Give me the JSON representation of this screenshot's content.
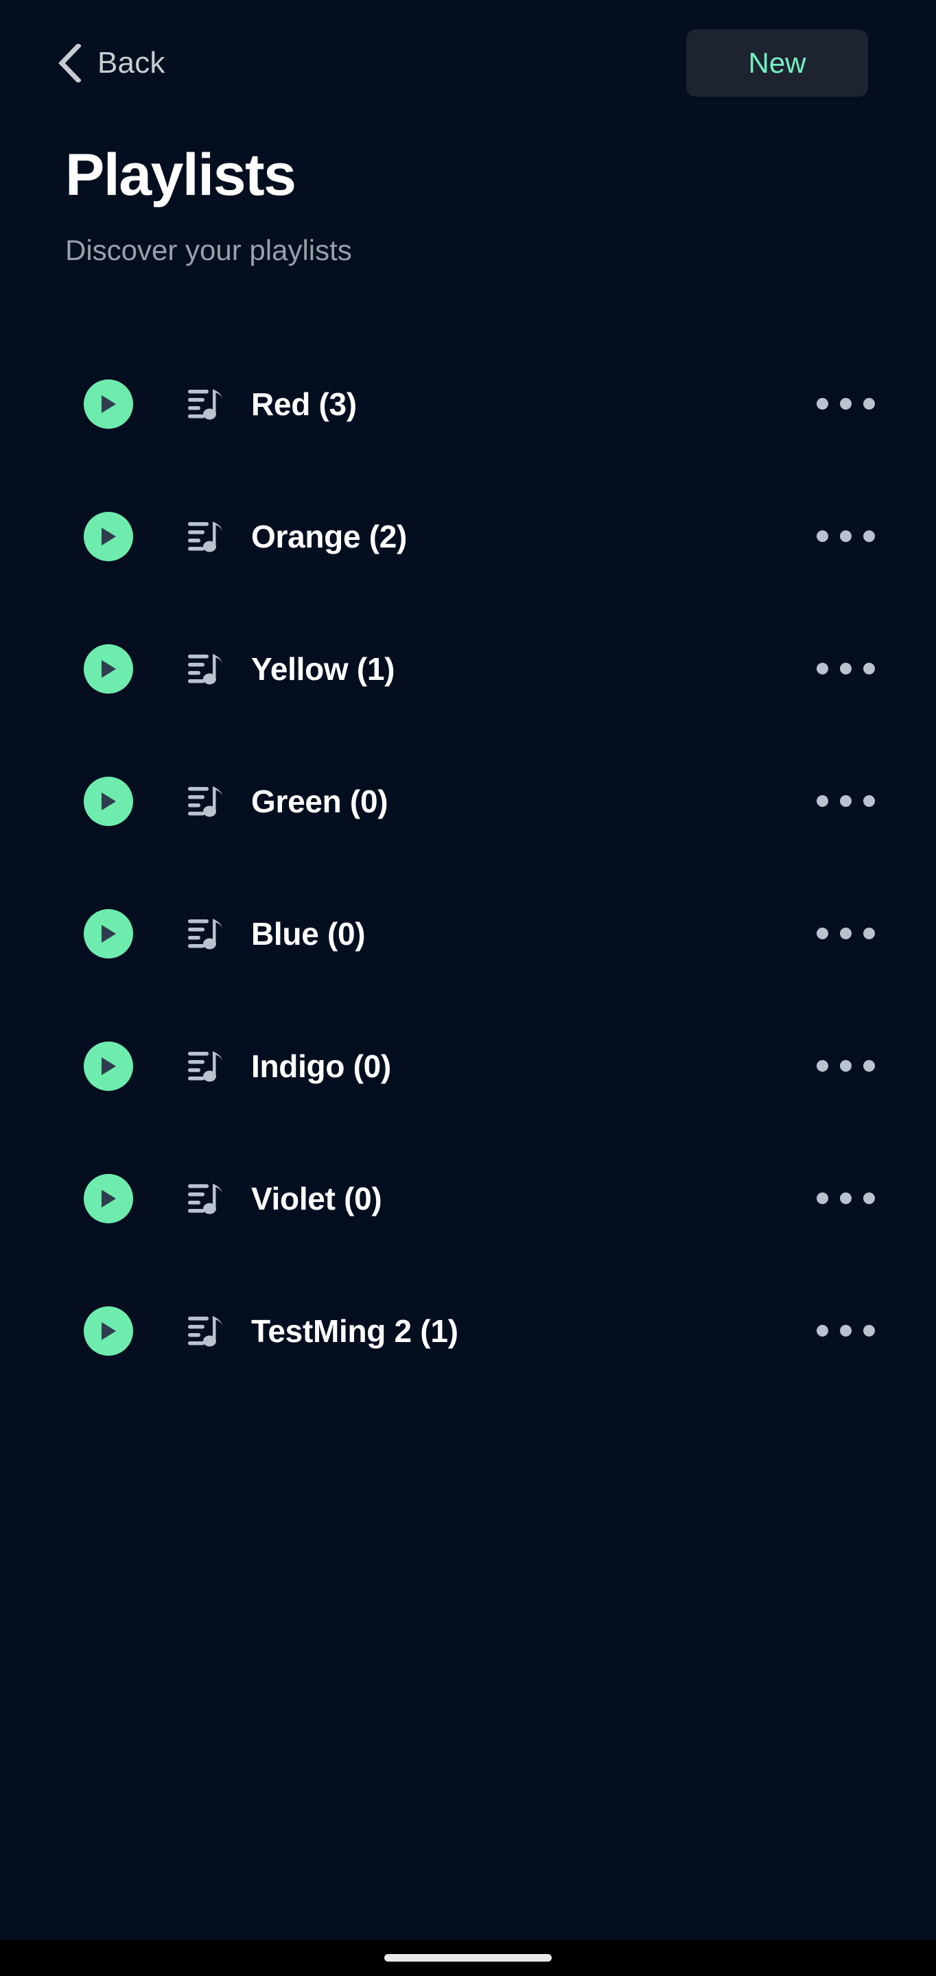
{
  "theme": {
    "background": "#050e1f",
    "accent_green": "#6eecae",
    "accent_teal_text": "#74f0c0",
    "surface": "#1e2331",
    "text_primary": "#ffffff",
    "text_secondary": "#9aa0a9",
    "icon_grey": "#b9c2ce",
    "play_glyph": "#2f3e4e"
  },
  "nav": {
    "back_label": "Back",
    "back_icon": "chevron-left-icon",
    "new_label": "New"
  },
  "header": {
    "title": "Playlists",
    "subtitle": "Discover your playlists"
  },
  "list": {
    "play_icon": "play-triangle-icon",
    "item_icon": "music-note-icon",
    "more_icon": "more-horizontal-icon",
    "items": [
      {
        "label": "Red (3)",
        "name": "Red",
        "count": 3
      },
      {
        "label": "Orange (2)",
        "name": "Orange",
        "count": 2
      },
      {
        "label": "Yellow (1)",
        "name": "Yellow",
        "count": 1
      },
      {
        "label": "Green (0)",
        "name": "Green",
        "count": 0
      },
      {
        "label": "Blue (0)",
        "name": "Blue",
        "count": 0
      },
      {
        "label": "Indigo (0)",
        "name": "Indigo",
        "count": 0
      },
      {
        "label": "Violet (0)",
        "name": "Violet",
        "count": 0
      },
      {
        "label": "TestMing 2 (1)",
        "name": "TestMing 2",
        "count": 1
      }
    ]
  },
  "system": {
    "home_indicator": "home-indicator"
  }
}
